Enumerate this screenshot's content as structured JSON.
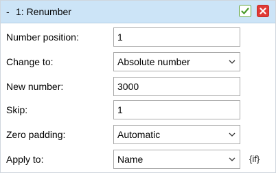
{
  "panel": {
    "collapse_symbol": "-",
    "title": "1: Renumber",
    "buttons": [
      {
        "name": "confirm-button",
        "icon": "check-icon",
        "color": "#5fa238"
      },
      {
        "name": "close-button",
        "icon": "close-icon",
        "color": "#e03a35"
      }
    ]
  },
  "fields": {
    "number_position": {
      "label": "Number position:",
      "value": "1",
      "type": "text"
    },
    "change_to": {
      "label": "Change to:",
      "value": "Absolute number",
      "type": "select"
    },
    "new_number": {
      "label": "New number:",
      "value": "3000",
      "type": "text"
    },
    "skip": {
      "label": "Skip:",
      "value": "1",
      "type": "text"
    },
    "zero_padding": {
      "label": "Zero padding:",
      "value": "Automatic",
      "type": "select"
    },
    "apply_to": {
      "label": "Apply to:",
      "value": "Name",
      "type": "select",
      "suffix": "{if}"
    }
  },
  "colors": {
    "titlebar_bg": "#cce4f7",
    "field_border": "#a9a9a9"
  }
}
